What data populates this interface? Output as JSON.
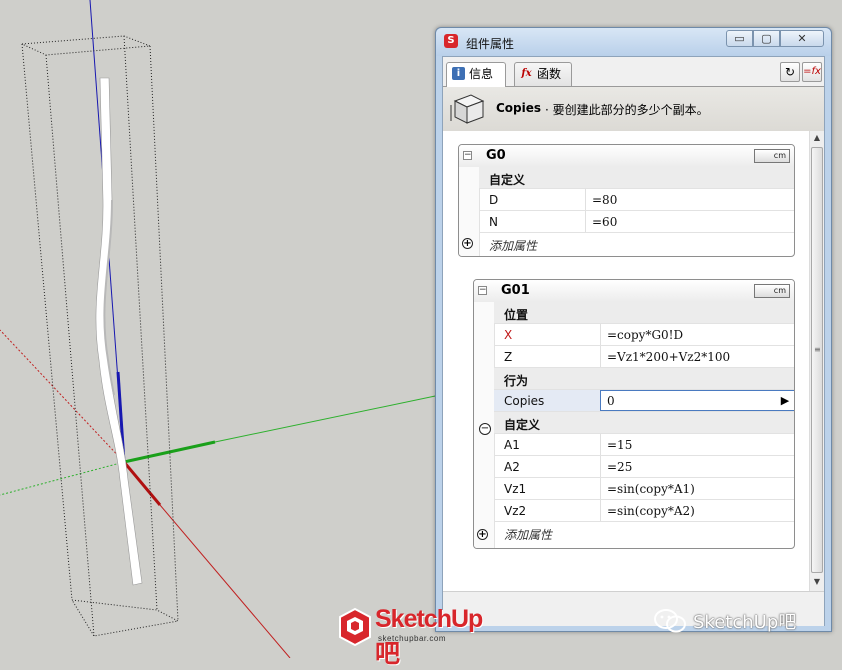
{
  "window": {
    "title": "组件属性",
    "app_icon": "sketchup-icon",
    "controls": {
      "minimize": "▭",
      "maximize": "▢",
      "close": "✕"
    }
  },
  "tabs": [
    {
      "label": "信息",
      "icon": "info-icon"
    },
    {
      "label": "函数",
      "icon": "function-icon"
    }
  ],
  "toolbar": {
    "refresh_icon": "↻",
    "formula_icon": "=fx"
  },
  "description": {
    "name": "Copies",
    "text": "· 要创建此部分的多少个副本。"
  },
  "groups": {
    "g0": {
      "name": "G0",
      "unit": "cm",
      "rows": [
        {
          "key": "自定义",
          "section": true
        },
        {
          "key": "D",
          "value": "=80"
        },
        {
          "key": "N",
          "value": "=60"
        }
      ],
      "add_label": "添加属性"
    },
    "g01": {
      "name": "G01",
      "unit": "cm",
      "position_section": "位置",
      "x_key": "X",
      "x_value": "=copy*G0!D",
      "z_key": "Z",
      "z_value": "=Vz1*200+Vz2*100",
      "behavior_section": "行为",
      "copies_key": "Copies",
      "copies_value": "0",
      "custom_section": "自定义",
      "a1_key": "A1",
      "a1_value": "=15",
      "a2_key": "A2",
      "a2_value": "=25",
      "vz1_key": "Vz1",
      "vz1_value": "=sin(copy*A1)",
      "vz2_key": "Vz2",
      "vz2_value": "=sin(copy*A2)",
      "add_label": "添加属性"
    }
  },
  "collapse_glyph": "−",
  "add_glyph": "+",
  "watermarks": {
    "logo_text": "SketchUp吧",
    "logo_sub": "sketchupbar.com",
    "wechat_text": "SketchUp吧"
  },
  "colors": {
    "axis_red": "#b01010",
    "axis_green": "#1aa01a",
    "axis_blue": "#1818b0",
    "brand_red": "#d8262b"
  }
}
